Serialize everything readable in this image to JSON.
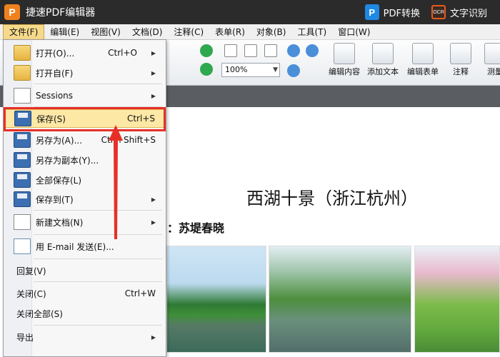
{
  "window": {
    "app_logo_letter": "P",
    "title": "捷速PDF编辑器",
    "pdf_convert_label": "PDF转换",
    "ocr_icon_text": "OCR",
    "ocr_label": "文字识别"
  },
  "menubar": [
    "文件(F)",
    "编辑(E)",
    "视图(V)",
    "文档(D)",
    "注释(C)",
    "表单(R)",
    "对象(B)",
    "工具(T)",
    "窗口(W)"
  ],
  "toolbar": {
    "zoom_value": "100%",
    "edit_content": "编辑内容",
    "add_text": "添加文本",
    "edit_form": "编辑表单",
    "annotate": "注释",
    "measure": "测量"
  },
  "file_menu": {
    "open": {
      "label": "打开(O)...",
      "shortcut": "Ctrl+O"
    },
    "open_from": {
      "label": "打开自(F)"
    },
    "sessions": {
      "label": "Sessions"
    },
    "save": {
      "label": "保存(S)",
      "shortcut": "Ctrl+S"
    },
    "save_as": {
      "label": "另存为(A)...",
      "shortcut": "Ctrl+Shift+S"
    },
    "save_copy": {
      "label": "另存为副本(Y)..."
    },
    "save_all": {
      "label": "全部保存(L)"
    },
    "save_to": {
      "label": "保存到(T)"
    },
    "new_doc": {
      "label": "新建文档(N)"
    },
    "email": {
      "label": "用 E-mail 发送(E)..."
    },
    "revert": {
      "label": "回复(V)"
    },
    "close": {
      "label": "关闭(C)",
      "shortcut": "Ctrl+W"
    },
    "close_all": {
      "label": "关闭全部(S)"
    },
    "export": {
      "label": "导出"
    }
  },
  "document": {
    "title": "西湖十景（浙江杭州）",
    "subtitle": "：苏堤春晓"
  },
  "colors": {
    "highlight_border": "#e63027",
    "accent": "#f0821e"
  }
}
